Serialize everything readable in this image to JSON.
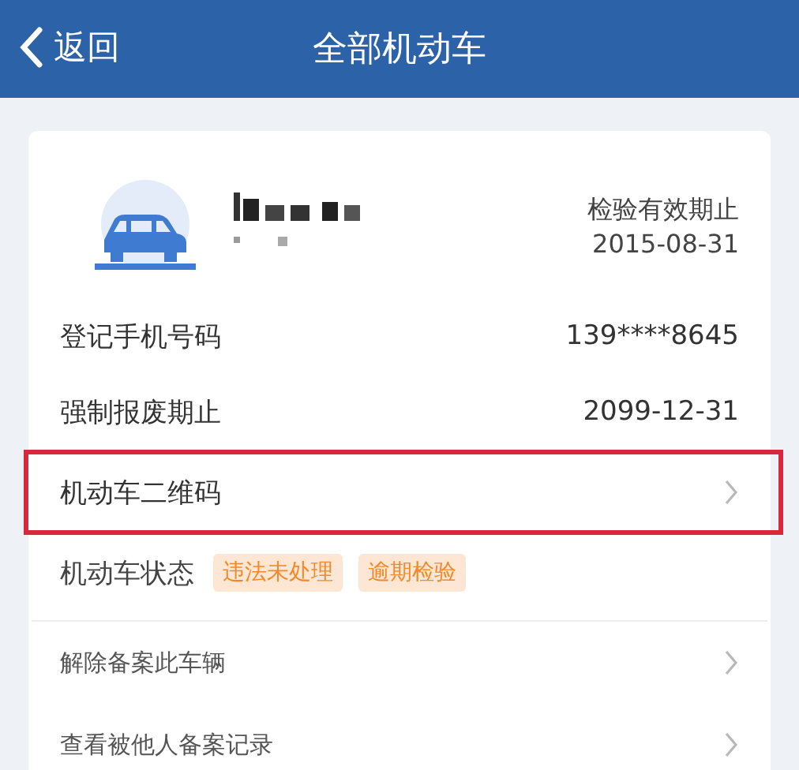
{
  "header": {
    "back": "返回",
    "title": "全部机动车"
  },
  "vehicle": {
    "inspection_label": "检验有效期止",
    "inspection_date": "2015-08-31"
  },
  "details": [
    {
      "kind": "value",
      "label": "登记手机号码",
      "value": "139****8645",
      "highlighted": false
    },
    {
      "kind": "value",
      "label": "强制报废期止",
      "value": "2099-12-31",
      "highlighted": false
    },
    {
      "kind": "link",
      "label": "机动车二维码",
      "highlighted": true
    },
    {
      "kind": "tags",
      "label": "机动车状态",
      "tags": [
        "违法未处理",
        "逾期检验"
      ],
      "highlighted": false
    }
  ],
  "actions": [
    {
      "label": "解除备案此车辆"
    },
    {
      "label": "查看被他人备案记录"
    }
  ]
}
